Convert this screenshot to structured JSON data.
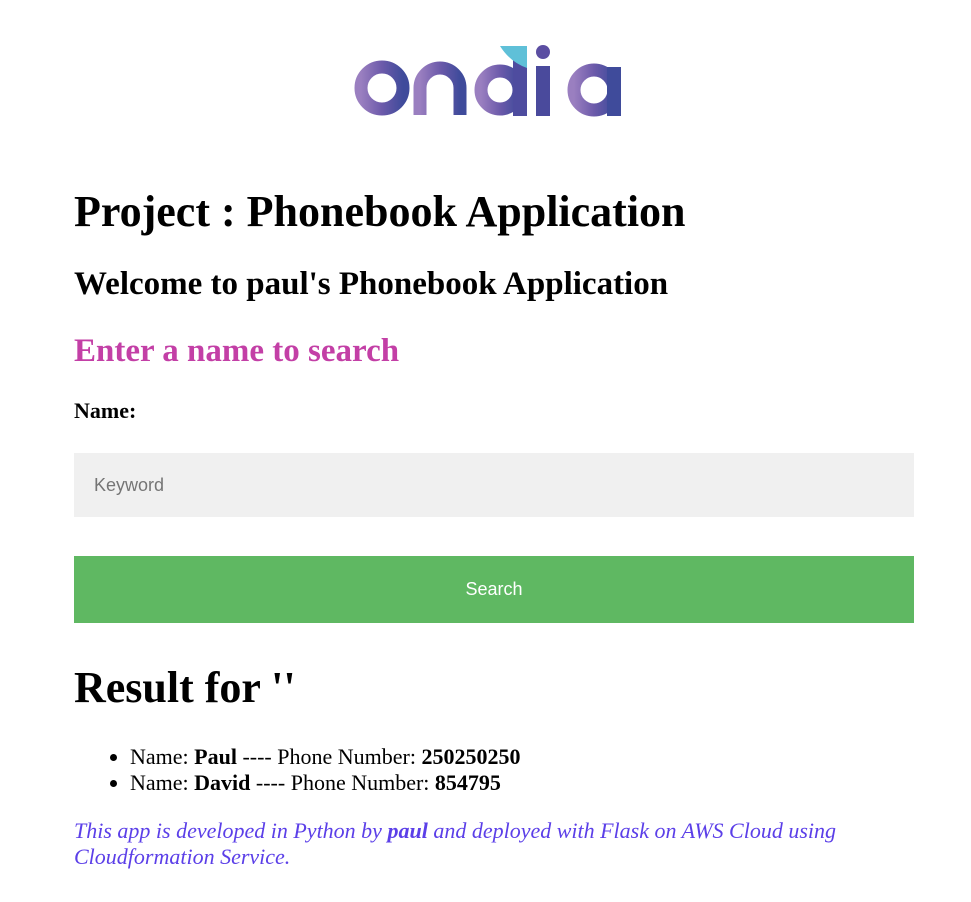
{
  "logo": {
    "text": "ondia",
    "icon": "ondia-logo",
    "colors": [
      "#8d74b5",
      "#5b4ea2",
      "#3f4b9b",
      "#5fc0d8"
    ]
  },
  "headings": {
    "project": "Project : Phonebook Application",
    "welcome": "Welcome to paul's Phonebook Application",
    "enter": "Enter a name to search"
  },
  "form": {
    "name_label": "Name:",
    "keyword_placeholder": "Keyword",
    "keyword_value": "",
    "search_label": "Search"
  },
  "result": {
    "heading": "Result for ''",
    "items": [
      {
        "name_prefix": "Name: ",
        "name": "Paul",
        "sep": " ---- Phone Number: ",
        "phone": "250250250"
      },
      {
        "name_prefix": "Name: ",
        "name": "David",
        "sep": " ---- Phone Number: ",
        "phone": "854795"
      }
    ]
  },
  "footer": {
    "part1": "This app is developed in Python by ",
    "author": "paul",
    "part2": " and deployed with Flask on AWS Cloud using Cloudformation Service."
  },
  "colors": {
    "enter_heading": "#c33fa6",
    "search_button": "#5fb862",
    "footer_text": "#5b3fe8",
    "input_bg": "#f0f0f0"
  }
}
